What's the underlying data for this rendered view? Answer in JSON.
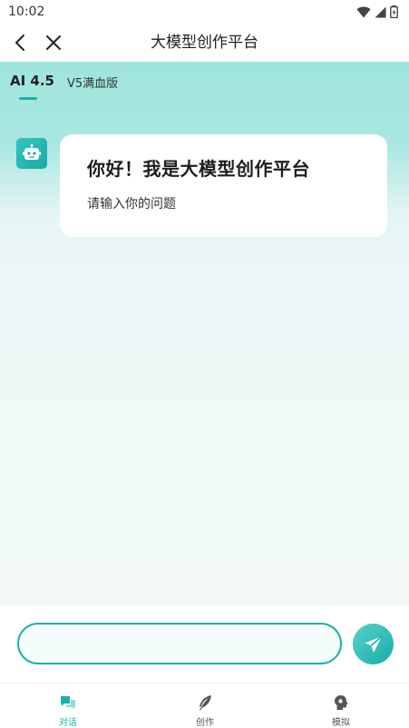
{
  "status_bar": {
    "time": "10:02"
  },
  "titlebar": {
    "title": "大模型创作平台"
  },
  "tabs": [
    {
      "label": "AI 4.5",
      "active": true
    },
    {
      "label": "V5满血版",
      "active": false
    }
  ],
  "message": {
    "greeting": "你好！我是大模型创作平台",
    "hint": "请输入你的问题"
  },
  "input": {
    "value": "",
    "placeholder": ""
  },
  "bottom_nav": [
    {
      "label": "对话",
      "icon": "chat-icon",
      "active": true
    },
    {
      "label": "创作",
      "icon": "feather-icon",
      "active": false
    },
    {
      "label": "模拟",
      "icon": "profile-head-icon",
      "active": false
    }
  ],
  "colors": {
    "accent": "#16b2ad",
    "header_gradient_top": "#9fe5dd",
    "background": "#f2f8f8"
  }
}
